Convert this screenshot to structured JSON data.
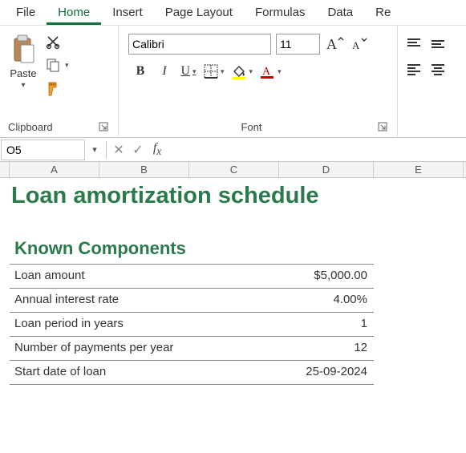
{
  "tabs": {
    "file": "File",
    "home": "Home",
    "insert": "Insert",
    "page_layout": "Page Layout",
    "formulas": "Formulas",
    "data": "Data",
    "review_partial": "Re"
  },
  "ribbon": {
    "clipboard": {
      "paste": "Paste",
      "label": "Clipboard"
    },
    "font": {
      "name": "Calibri",
      "size": "11",
      "bold": "B",
      "italic": "I",
      "underline": "U",
      "increase": "A",
      "decrease": "A",
      "label": "Font"
    }
  },
  "formula_bar": {
    "name_box": "O5",
    "formula": ""
  },
  "columns": {
    "A": "A",
    "B": "B",
    "C": "C",
    "D": "D",
    "E": "E"
  },
  "sheet": {
    "title": "Loan amortization schedule",
    "subtitle": "Known Components",
    "rows": [
      {
        "label": "Loan amount",
        "value": "$5,000.00"
      },
      {
        "label": "Annual interest rate",
        "value": "4.00%"
      },
      {
        "label": "Loan period in years",
        "value": "1"
      },
      {
        "label": "Number of payments per year",
        "value": "12"
      },
      {
        "label": "Start date of loan",
        "value": "25-09-2024"
      }
    ]
  }
}
